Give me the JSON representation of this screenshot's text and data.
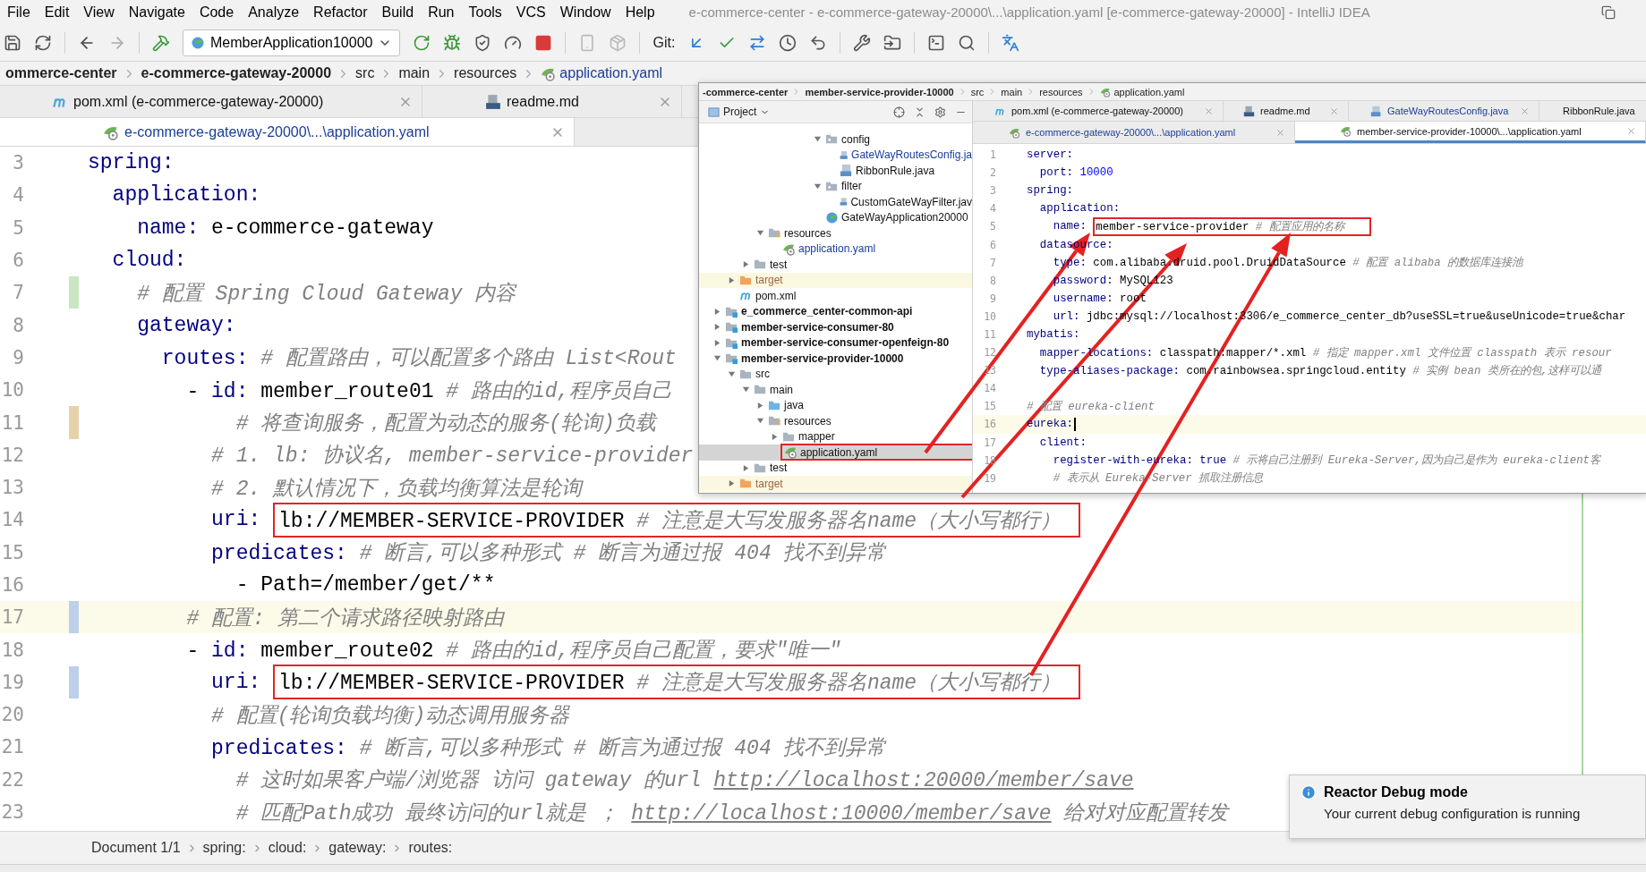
{
  "window": {
    "title": "e-commerce-center - e-commerce-gateway-20000\\...\\application.yaml [e-commerce-gateway-20000] - IntelliJ IDEA"
  },
  "menu": [
    "File",
    "Edit",
    "View",
    "Navigate",
    "Code",
    "Analyze",
    "Refactor",
    "Build",
    "Run",
    "Tools",
    "VCS",
    "Window",
    "Help"
  ],
  "toolbar": {
    "run_config": "MemberApplication10000",
    "git_label": "Git:"
  },
  "breadcrumbs": [
    {
      "label": "ommerce-center",
      "kind": "module"
    },
    {
      "label": "e-commerce-gateway-20000",
      "kind": "module"
    },
    {
      "label": "src",
      "kind": "folder"
    },
    {
      "label": "main",
      "kind": "folder"
    },
    {
      "label": "resources",
      "kind": "folder"
    },
    {
      "label": "application.yaml",
      "kind": "file"
    }
  ],
  "tabs": [
    {
      "label": "pom.xml (e-commerce-gateway-20000)",
      "kind": "maven",
      "selected": false,
      "modified": false
    },
    {
      "label": "readme.md",
      "kind": "markdown",
      "selected": false,
      "modified": false
    }
  ],
  "tabs_row2": [
    {
      "label": "e-commerce-gateway-20000\\...\\application.yaml",
      "kind": "yaml",
      "selected": true,
      "modified": true
    }
  ],
  "editor": {
    "lines": [
      {
        "number": "3",
        "current": false,
        "segments": [
          {
            "kind": "key",
            "text": "spring:"
          }
        ]
      },
      {
        "number": "4",
        "current": false,
        "segments": [
          {
            "kind": "key",
            "text": "  application:"
          }
        ]
      },
      {
        "number": "5",
        "current": false,
        "segments": [
          {
            "kind": "key",
            "text": "    name: "
          },
          {
            "kind": "value",
            "text": "e-commerce-gateway"
          }
        ]
      },
      {
        "number": "6",
        "current": false,
        "segments": [
          {
            "kind": "key",
            "text": "  cloud:"
          }
        ]
      },
      {
        "number": "7",
        "current": false,
        "color": "#c9e6c3",
        "segments": [
          {
            "kind": "comment",
            "text": "    # 配置 Spring Cloud Gateway 内容"
          }
        ]
      },
      {
        "number": "8",
        "current": false,
        "segments": [
          {
            "kind": "key",
            "text": "    gateway:"
          }
        ]
      },
      {
        "number": "9",
        "current": false,
        "segments": [
          {
            "kind": "key",
            "text": "      routes: "
          },
          {
            "kind": "comment",
            "text": "# 配置路由，可以配置多个路由 List<Rout"
          }
        ]
      },
      {
        "number": "10",
        "current": false,
        "segments": [
          {
            "kind": "value",
            "text": "        - "
          },
          {
            "kind": "key",
            "text": "id: "
          },
          {
            "kind": "value",
            "text": "member_route01 "
          },
          {
            "kind": "comment",
            "text": "# 路由的id,程序员自己"
          }
        ]
      },
      {
        "number": "11",
        "current": false,
        "color": "#e6d2a8",
        "segments": [
          {
            "kind": "comment",
            "text": "            # 将查询服务，配置为动态的服务(轮询)负载"
          }
        ]
      },
      {
        "number": "12",
        "current": false,
        "segments": [
          {
            "kind": "comment",
            "text": "          # 1. lb: 协议名, member-service-provider"
          }
        ]
      },
      {
        "number": "13",
        "current": false,
        "segments": [
          {
            "kind": "comment",
            "text": "          # 2. 默认情况下，负载均衡算法是轮询"
          }
        ]
      },
      {
        "number": "14",
        "current": false,
        "segments": [
          {
            "kind": "key",
            "text": "          uri: "
          },
          {
            "kind": "box",
            "segments": [
              {
                "kind": "value",
                "text": "lb://MEMBER-SERVICE-PROVIDER "
              },
              {
                "kind": "comment",
                "text": "# 注意是大写发服务器名name（大小写都行）"
              }
            ]
          }
        ]
      },
      {
        "number": "15",
        "current": false,
        "segments": [
          {
            "kind": "key",
            "text": "          predicates: "
          },
          {
            "kind": "comment",
            "text": "# 断言,可以多种形式 # 断言为通过报 404 找不到异常"
          }
        ]
      },
      {
        "number": "16",
        "current": false,
        "segments": [
          {
            "kind": "value",
            "text": "            - Path=/member/get/**"
          }
        ]
      },
      {
        "number": "17",
        "current": true,
        "color": "#bcd0ea",
        "segments": [
          {
            "kind": "comment",
            "text": "        # 配置: 第二个请求路径映射路由"
          }
        ]
      },
      {
        "number": "18",
        "current": false,
        "segments": [
          {
            "kind": "value",
            "text": "        - "
          },
          {
            "kind": "key",
            "text": "id: "
          },
          {
            "kind": "value",
            "text": "member_route02 "
          },
          {
            "kind": "comment",
            "text": "# 路由的id,程序员自己配置，要求\"唯一\""
          }
        ]
      },
      {
        "number": "19",
        "current": false,
        "color": "#bcd0ea",
        "segments": [
          {
            "kind": "key",
            "text": "          uri: "
          },
          {
            "kind": "box",
            "segments": [
              {
                "kind": "value",
                "text": "lb://MEMBER-SERVICE-PROVIDER "
              },
              {
                "kind": "comment",
                "text": "# 注意是大写发服务器名name（大小写都行）"
              }
            ]
          }
        ]
      },
      {
        "number": "20",
        "current": false,
        "segments": [
          {
            "kind": "comment",
            "text": "          # 配置(轮询负载均衡)动态调用服务器"
          }
        ]
      },
      {
        "number": "21",
        "current": false,
        "segments": [
          {
            "kind": "key",
            "text": "          predicates: "
          },
          {
            "kind": "comment",
            "text": "# 断言,可以多种形式 # 断言为通过报 404 找不到异常"
          }
        ]
      },
      {
        "number": "22",
        "current": false,
        "segments": [
          {
            "kind": "comment",
            "text": "            # 这时如果客户端/浏览器 访问 gateway 的url "
          },
          {
            "kind": "link",
            "text": "http://localhost:20000/member/save"
          }
        ]
      },
      {
        "number": "23",
        "current": false,
        "segments": [
          {
            "kind": "comment",
            "text": "            # 匹配Path成功 最终访问的url就是 ； "
          },
          {
            "kind": "link",
            "text": "http://localhost:10000/member/save"
          },
          {
            "kind": "comment",
            "text": " 给对对应配置转发"
          }
        ]
      }
    ]
  },
  "status_breadcrumbs": [
    "Document 1/1",
    "spring:",
    "cloud:",
    "gateway:",
    "routes:"
  ],
  "inset": {
    "breadcrumbs": [
      {
        "label": "-commerce-center",
        "kind": "module"
      },
      {
        "label": "member-service-provider-10000",
        "kind": "module"
      },
      {
        "label": "src",
        "kind": "folder"
      },
      {
        "label": "main",
        "kind": "folder"
      },
      {
        "label": "resources",
        "kind": "folder"
      },
      {
        "label": "application.yaml",
        "kind": "file"
      }
    ],
    "project_label": "Project",
    "tree": [
      {
        "children": [
          {
            "children": [
              {
                "children": [
                  {
                    "children": [
                      {
                        "children": [
                          {
                            "children": [
                              {
                                "children": [
                                  {
                                    "label": "config",
                                    "kind": "package",
                                    "expanded": true,
                                    "selected": false,
                                    "modified": false,
                                    "boxed": false,
                                    "children": [
                                      {
                                        "label": "GateWayRoutesConfig.ja",
                                        "kind": "java",
                                        "selected": false,
                                        "modified": true,
                                        "boxed": false
                                      },
                                      {
                                        "label": "RibbonRule.java",
                                        "kind": "java",
                                        "selected": false,
                                        "modified": false,
                                        "boxed": false
                                      }
                                    ]
                                  },
                                  {
                                    "label": "filter",
                                    "kind": "package",
                                    "expanded": true,
                                    "selected": false,
                                    "modified": false,
                                    "boxed": false,
                                    "children": [
                                      {
                                        "label": "CustomGateWayFilter.jav",
                                        "kind": "java",
                                        "selected": false,
                                        "modified": false,
                                        "boxed": false
                                      }
                                    ]
                                  },
                                  {
                                    "label": "GateWayApplication20000",
                                    "kind": "app",
                                    "selected": false,
                                    "modified": false,
                                    "boxed": false
                                  }
                                ]
                              }
                            ]
                          }
                        ]
                      }
                    ]
                  },
                  {
                    "label": "resources",
                    "kind": "resources",
                    "expanded": true,
                    "selected": false,
                    "modified": false,
                    "boxed": false,
                    "children": [
                      {
                        "label": "application.yaml",
                        "kind": "yaml",
                        "selected": false,
                        "modified": true,
                        "boxed": false
                      }
                    ]
                  }
                ]
              },
              {
                "label": "test",
                "kind": "folder",
                "expanded": false,
                "selected": false,
                "modified": false,
                "boxed": false
              }
            ]
          },
          {
            "label": "target",
            "kind": "excluded",
            "expanded": false,
            "selected": false,
            "modified": false,
            "boxed": false
          },
          {
            "label": "pom.xml",
            "kind": "maven",
            "selected": false,
            "modified": false,
            "boxed": false
          }
        ]
      },
      {
        "label": "e_commerce_center-common-api",
        "kind": "module",
        "expanded": false,
        "selected": false,
        "modified": false,
        "boxed": false
      },
      {
        "label": "member-service-consumer-80",
        "kind": "module",
        "expanded": false,
        "selected": false,
        "modified": false,
        "boxed": false
      },
      {
        "label": "member-service-consumer-openfeign-80",
        "kind": "module",
        "expanded": false,
        "selected": false,
        "modified": false,
        "boxed": false
      },
      {
        "label": "member-service-provider-10000",
        "kind": "module",
        "expanded": true,
        "selected": false,
        "modified": false,
        "boxed": false,
        "children": [
          {
            "label": "src",
            "kind": "folder",
            "expanded": true,
            "selected": false,
            "modified": false,
            "boxed": false,
            "children": [
              {
                "label": "main",
                "kind": "folder",
                "expanded": true,
                "selected": false,
                "modified": false,
                "boxed": false,
                "children": [
                  {
                    "label": "java",
                    "kind": "source",
                    "expanded": false,
                    "selected": false,
                    "modified": false,
                    "boxed": false
                  },
                  {
                    "label": "resources",
                    "kind": "resources",
                    "expanded": true,
                    "selected": false,
                    "modified": false,
                    "boxed": false,
                    "children": [
                      {
                        "label": "mapper",
                        "kind": "folder",
                        "expanded": false,
                        "selected": false,
                        "modified": false,
                        "boxed": false
                      },
                      {
                        "label": "application.yaml",
                        "kind": "yaml",
                        "selected": true,
                        "modified": false,
                        "boxed": true
                      }
                    ]
                  }
                ]
              },
              {
                "label": "test",
                "kind": "folder",
                "expanded": false,
                "selected": false,
                "modified": false,
                "boxed": false
              }
            ]
          },
          {
            "label": "target",
            "kind": "excluded",
            "expanded": false,
            "selected": false,
            "modified": false,
            "boxed": false
          }
        ]
      }
    ],
    "tabs": [
      {
        "label": "pom.xml (e-commerce-gateway-20000)",
        "kind": "maven",
        "selected": false,
        "modified": false
      },
      {
        "label": "readme.md",
        "kind": "markdown",
        "selected": false,
        "modified": false
      },
      {
        "label": "GateWayRoutesConfig.java",
        "kind": "java",
        "selected": false,
        "modified": true
      },
      {
        "label": "RibbonRule.java",
        "kind": "java",
        "selected": false,
        "modified": false
      }
    ],
    "tabs_row2": [
      {
        "label": "e-commerce-gateway-20000\\...\\application.yaml",
        "kind": "yaml",
        "selected": false,
        "modified": true
      },
      {
        "label": "member-service-provider-10000\\...\\application.yaml",
        "kind": "yaml",
        "selected": true,
        "modified": false
      }
    ],
    "lines": [
      {
        "number": "1",
        "current": false,
        "segments": [
          {
            "kind": "key",
            "text": "server:"
          }
        ]
      },
      {
        "number": "2",
        "current": false,
        "segments": [
          {
            "kind": "key",
            "text": "  port: "
          },
          {
            "kind": "number",
            "text": "10000"
          }
        ]
      },
      {
        "number": "3",
        "current": false,
        "segments": [
          {
            "kind": "key",
            "text": "spring:"
          }
        ]
      },
      {
        "number": "4",
        "current": false,
        "segments": [
          {
            "kind": "key",
            "text": "  application:"
          }
        ]
      },
      {
        "number": "5",
        "current": false,
        "segments": [
          {
            "kind": "key",
            "text": "    name: "
          },
          {
            "kind": "box",
            "segments": [
              {
                "kind": "value",
                "text": "member-service-provider "
              },
              {
                "kind": "comment",
                "text": "# 配置应用的名称"
              }
            ]
          }
        ]
      },
      {
        "number": "6",
        "current": false,
        "segments": [
          {
            "kind": "key",
            "text": "  datasource:"
          }
        ]
      },
      {
        "number": "7",
        "current": false,
        "segments": [
          {
            "kind": "key",
            "text": "    type: "
          },
          {
            "kind": "value",
            "text": "com.alibaba.druid.pool.DruidDataSource "
          },
          {
            "kind": "comment",
            "text": "# 配置 alibaba 的数据库连接池"
          }
        ]
      },
      {
        "number": "8",
        "current": false,
        "segments": [
          {
            "kind": "key",
            "text": "    password: "
          },
          {
            "kind": "value",
            "text": "MySQL123"
          }
        ]
      },
      {
        "number": "9",
        "current": false,
        "segments": [
          {
            "kind": "key",
            "text": "    username: "
          },
          {
            "kind": "value",
            "text": "root"
          }
        ]
      },
      {
        "number": "10",
        "current": false,
        "segments": [
          {
            "kind": "key",
            "text": "    url: "
          },
          {
            "kind": "value",
            "text": "jdbc:mysql://localhost:3306/e_commerce_center_db?useSSL=true&useUnicode=true&char"
          }
        ]
      },
      {
        "number": "11",
        "current": false,
        "segments": [
          {
            "kind": "key",
            "text": "mybatis:"
          }
        ]
      },
      {
        "number": "12",
        "current": false,
        "segments": [
          {
            "kind": "key",
            "text": "  mapper-locations: "
          },
          {
            "kind": "value",
            "text": "classpath:mapper/*.xml "
          },
          {
            "kind": "comment",
            "text": "# 指定 mapper.xml 文件位置 classpath 表示 resour"
          }
        ]
      },
      {
        "number": "13",
        "current": false,
        "segments": [
          {
            "kind": "key",
            "text": "  type-aliases-package: "
          },
          {
            "kind": "value",
            "text": "com.rainbowsea.springcloud.entity "
          },
          {
            "kind": "comment",
            "text": "# 实例 bean 类所在的包,这样可以通"
          }
        ]
      },
      {
        "number": "14",
        "current": false
      },
      {
        "number": "15",
        "current": false,
        "segments": [
          {
            "kind": "comment",
            "text": "# 配置 eureka-client"
          }
        ]
      },
      {
        "number": "16",
        "current": true,
        "segments": [
          {
            "kind": "key",
            "text": "eureka:"
          }
        ]
      },
      {
        "number": "17",
        "current": false,
        "segments": [
          {
            "kind": "key",
            "text": "  client:"
          }
        ]
      },
      {
        "number": "18",
        "current": false,
        "segments": [
          {
            "kind": "key",
            "text": "    register-with-eureka: "
          },
          {
            "kind": "literal",
            "text": "true "
          },
          {
            "kind": "comment",
            "text": "# 示将自己注册到 Eureka-Server,因为自己是作为 eureka-client客"
          }
        ]
      },
      {
        "number": "19",
        "current": false,
        "segments": [
          {
            "kind": "comment",
            "text": "    # 表示从 Eureka-Server 抓取注册信息"
          }
        ]
      }
    ]
  },
  "notification": {
    "title": "Reactor Debug mode",
    "text": "Your current debug configuration is running"
  }
}
